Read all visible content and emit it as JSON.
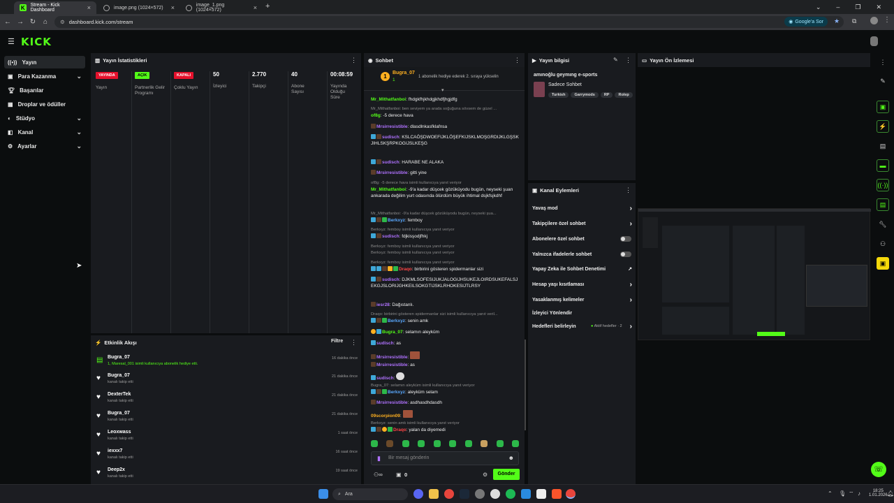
{
  "browser": {
    "tabs": [
      {
        "label": "Stream - Kick Dashboard"
      },
      {
        "label": "image.png (1024×572)"
      },
      {
        "label": "image_1.png (1024×572)"
      }
    ],
    "url": "dashboard.kick.com/stream",
    "ask_google": "Google'a Sor"
  },
  "kick": {
    "logo": "KICK"
  },
  "sidebar": {
    "items": [
      {
        "label": "Yayın",
        "icon": "broadcast-icon"
      },
      {
        "label": "Para Kazanma",
        "icon": "money-icon"
      },
      {
        "label": "Başarılar",
        "icon": "trophy-icon"
      },
      {
        "label": "Droplar ve ödüller",
        "icon": "gift-icon"
      },
      {
        "label": "Stüdyo",
        "icon": "studio-icon"
      },
      {
        "label": "Kanal",
        "icon": "channel-icon"
      },
      {
        "label": "Ayarlar",
        "icon": "gear-icon"
      }
    ]
  },
  "stats": {
    "title": "Yayın İstatistikleri",
    "items": [
      {
        "value": "YAYINDA",
        "label": "Yayın",
        "color": "#e5112c"
      },
      {
        "value": "AÇIK",
        "label": "Partnerlik Gelir Programı",
        "color": "#53fc18"
      },
      {
        "value": "KAPALI",
        "label": "Çoklu Yayın",
        "color": "#e5112c"
      },
      {
        "value": "50",
        "label": "İzleyici"
      },
      {
        "value": "2.770",
        "label": "Takipçi"
      },
      {
        "value": "40",
        "label": "Abone Sayısı"
      },
      {
        "value": "00:08:59",
        "label": "Yayında Olduğu Süre"
      }
    ]
  },
  "activity": {
    "title": "Etkinlik Akışı",
    "filter": "Filtre",
    "items": [
      {
        "name": "Bugra_07",
        "sub": "1, Maresal_001 isimli kullanıcıya abonelik hediye etti.",
        "time": "16 dakika önce"
      },
      {
        "name": "Bugra_07",
        "sub": "kanalı takip etti",
        "time": "21 dakika önce"
      },
      {
        "name": "DexterTek",
        "sub": "kanalı takip etti",
        "time": "21 dakika önce"
      },
      {
        "name": "Bugra_07",
        "sub": "kanalı takip etti",
        "time": "21 dakika önce"
      },
      {
        "name": "Leoxwass",
        "sub": "kanalı takip etti",
        "time": "1 saat önce"
      },
      {
        "name": "iexxx7",
        "sub": "kanalı takip etti",
        "time": "16 saat önce"
      },
      {
        "name": "Deep2x",
        "sub": "kanalı takip etti",
        "time": "19 saat önce"
      }
    ]
  },
  "chat": {
    "title": "Sohbet",
    "pinned": {
      "user": "Bugra_07",
      "count": "1",
      "text": "1 abonelik hediye ederek 2. sıraya yükselin"
    },
    "messages": [
      {
        "reply": "",
        "user": "Mr_Mithatfanboi",
        "text": "fhdgkfhjkhdgjkhdfjhgjdfg"
      },
      {
        "reply": "Mr_Mithatfanboi: ben seviyem ya arada soğuğuna sövsem de güzel ...",
        "user": "of8g",
        "text": "-5 derece hava"
      },
      {
        "reply": "",
        "user": "Mrsirresistible",
        "text": "dlasdlnkasfklafnsa"
      },
      {
        "reply": "",
        "user": "sudisch",
        "text": "KSLCAÖŞDWOEFIJKLÖŞEFKIJSKLMOŞGRDIJKLGŞSKJIHLSKŞRPKOGIJSLKEŞG"
      },
      {
        "reply": "",
        "user": "sudisch",
        "text": "HARABE NE ALAKA"
      },
      {
        "reply": "",
        "user": "Mrsirresistible",
        "text": "gitti yine"
      },
      {
        "reply": "of8g: -5 derece hava isimli kullanıcıya yanıt veriyor",
        "user": "Mr_Mithatfanboi",
        "text": "-9'a kadar düşcek gözüküyodu bugün, neyseki şuan ankarada değilim yurt odasında ölürdüm büyük ihtimal dsjkfsjkdhf"
      },
      {
        "reply": "Mr_Mithatfanboi: -9'a kadar düşcek gözüküyodu bugün, neyseki şua...",
        "user": "Berkxyz",
        "text": "femboy"
      },
      {
        "reply": "Berkxyz: femboy isimli kullanıcıya yanıt veriyor",
        "user": "sudisch",
        "text": "fdjkisşodjfhkj"
      },
      {
        "reply": "Berkxyz: femboy isimli kullanıcıya yanıt veriyor",
        "user": "Draqo",
        "text": "birbirini gösteren spidermanlar sizi"
      },
      {
        "reply": "",
        "user": "sudisch",
        "text": "DJKMLSOFESIJUKJALOGIJHSUKEJLOIRDSUKEFALSJEKGJSLORIJGHKEILSOKGTIJSKLRHOKESIJTLRSY"
      },
      {
        "reply": "",
        "user": "iesr28",
        "text": "Dağıstanlı."
      },
      {
        "reply": "Draqo: birbirini gösteren spidermanlar sizi isimli kullanıcıya yanıt veril...",
        "user": "Berkxyz",
        "text": "senin amk"
      },
      {
        "reply": "",
        "user": "Bugra_07",
        "text": "selamın aleyküm"
      },
      {
        "reply": "",
        "user": "sudisch",
        "text": "as"
      },
      {
        "reply": "",
        "user": "Mrsirresistible",
        "text": ""
      },
      {
        "reply": "",
        "user": "Mrsirresistible",
        "text": "as"
      },
      {
        "reply": "",
        "user": "sudisch",
        "text": ""
      },
      {
        "reply": "Bugra_07: selamın aleyküm isimli kullanıcıya yanıt veriyor",
        "user": "Berkxyz",
        "text": "aleyküm selam"
      },
      {
        "reply": "",
        "user": "Mrsirresistible",
        "text": "asdhasdhdasdh"
      },
      {
        "reply": "",
        "user": "09scorpion09",
        "text": ""
      },
      {
        "reply": "Berkxyz: senin amk isimli kullanıcıya yanıt veriyor",
        "user": "Draqo",
        "text": "yalan da diyemedi"
      }
    ],
    "input_placeholder": "Bir mesaj gönderin",
    "points": "0",
    "send": "Gönder"
  },
  "stream_info": {
    "title": "Yayın bilgisi",
    "stream_title": "amınoğlu geymıng e-sports",
    "category": "Sadece Sohbet",
    "tags": [
      "Turkish",
      "Garrymods",
      "RP",
      "Rolep"
    ]
  },
  "channel_actions": {
    "title": "Kanal Eylemleri",
    "items": [
      {
        "label": "Yavaş mod",
        "control": "arrow"
      },
      {
        "label": "Takipçilere özel sohbet",
        "control": "arrow"
      },
      {
        "label": "Abonelere özel sohbet",
        "control": "toggle"
      },
      {
        "label": "Yalnızca ifadelerle sohbet",
        "control": "toggle"
      },
      {
        "label": "Yapay Zeka ile Sohbet Denetimi",
        "control": "external"
      },
      {
        "label": "Hesap yaşı kısıtlaması",
        "control": "arrow"
      },
      {
        "label": "Yasaklanmış kelimeler",
        "control": "arrow"
      },
      {
        "label": "İzleyici Yönlendir",
        "control": "none"
      },
      {
        "label": "Hedefleri belirleyin",
        "control": "arrow"
      }
    ],
    "goals_status": "Aktif hedefler · 2"
  },
  "preview": {
    "title": "Yayın Ön İzlemesi"
  },
  "taskbar": {
    "search": "Ara",
    "time": "18:25",
    "date": "1.01.2026"
  }
}
